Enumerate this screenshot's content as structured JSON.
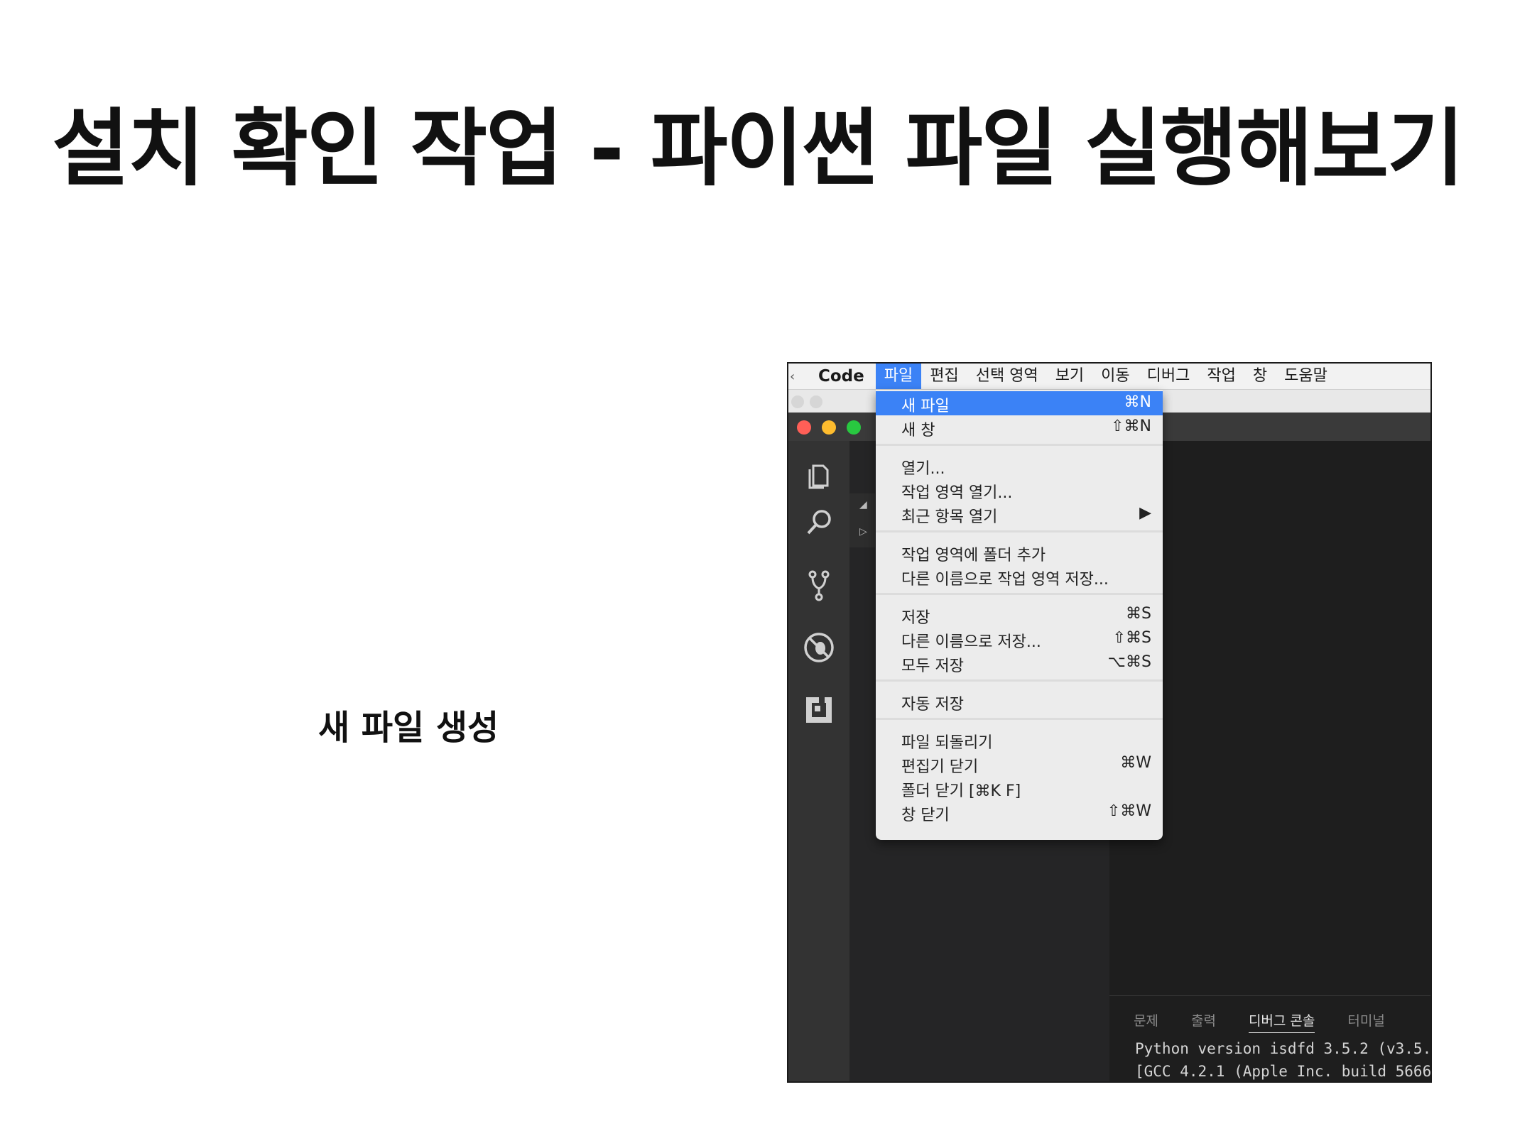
{
  "slide": {
    "title": "설치 확인 작업 - 파이썬 파일 실행해보기",
    "caption": "새 파일 생성"
  },
  "menubar": {
    "app_name": "Code",
    "items": [
      "파일",
      "편집",
      "선택 영역",
      "보기",
      "이동",
      "디버그",
      "작업",
      "창",
      "도움말"
    ],
    "active_item": "파일"
  },
  "file_menu": {
    "items": [
      {
        "label": "새 파일",
        "shortcut": "⌘N",
        "selected": true
      },
      {
        "label": "새 창",
        "shortcut": "⇧⌘N"
      },
      {
        "label": "열기...",
        "shortcut": ""
      },
      {
        "label": "작업 영역 열기...",
        "shortcut": ""
      },
      {
        "label": "최근 항목 열기",
        "shortcut": "▶"
      },
      {
        "label": "작업 영역에 폴더 추가",
        "shortcut": ""
      },
      {
        "label": "다른 이름으로 작업 영역 저장...",
        "shortcut": ""
      },
      {
        "label": "저장",
        "shortcut": "⌘S"
      },
      {
        "label": "다른 이름으로 저장...",
        "shortcut": "⇧⌘S"
      },
      {
        "label": "모두 저장",
        "shortcut": "⌥⌘S"
      },
      {
        "label": "자동 저장",
        "shortcut": ""
      },
      {
        "label": "파일 되돌리기",
        "shortcut": ""
      },
      {
        "label": "편집기 닫기",
        "shortcut": "⌘W"
      },
      {
        "label": "폴더 닫기 [⌘K F]",
        "shortcut": ""
      },
      {
        "label": "창 닫기",
        "shortcut": "⇧⌘W"
      }
    ]
  },
  "activity_bar": {
    "icons": [
      "files-icon",
      "search-icon",
      "source-control-icon",
      "debug-icon",
      "extensions-icon"
    ]
  },
  "traffic_lights": {
    "close": "#ff5f57",
    "minimize": "#febc2e",
    "zoom": "#28c840"
  },
  "panel": {
    "tabs": [
      "문제",
      "출력",
      "디버그 콘솔",
      "터미널"
    ],
    "active_tab": "디버그 콘솔",
    "console_lines": [
      "Python version isdfd 3.5.2 (v3.5.",
      "[GCC 4.2.1 (Apple Inc. build 5666"
    ]
  },
  "colors": {
    "accent": "#3b82f6",
    "editor_bg": "#1e1e1e",
    "activity_bg": "#333333"
  }
}
